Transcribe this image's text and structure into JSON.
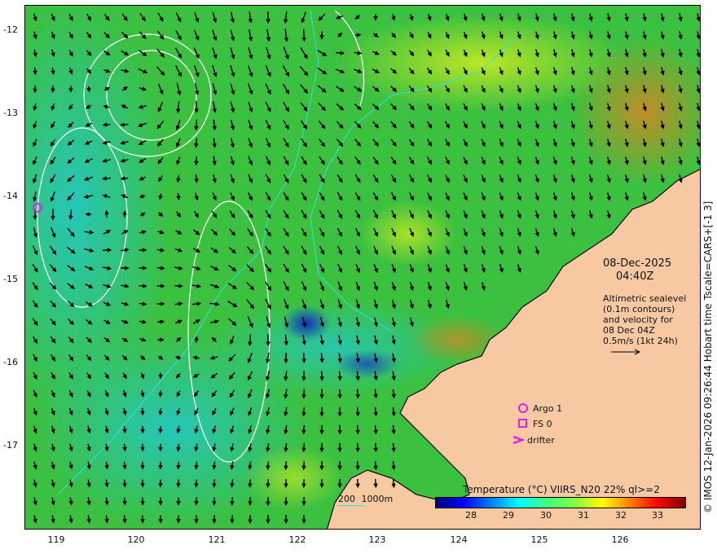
{
  "map": {
    "y_ticks": [
      "-12",
      "-13",
      "-14",
      "-15",
      "-16",
      "-17"
    ],
    "x_ticks": [
      "119",
      "120",
      "121",
      "122",
      "123",
      "124",
      "125",
      "126"
    ],
    "colors": {
      "land": "#f7c9a3",
      "sst_base": "#3fbf3f",
      "vector": "#000000",
      "contour": "#ffffff",
      "isobath": "#33e0e0"
    }
  },
  "annotations": {
    "date": "08-Dec-2025",
    "time": "04:40Z",
    "altimetry_lines": [
      "Altimetric sealevel",
      "(0.1m contours)",
      "and velocity for",
      "08 Dec 04Z",
      "0.5m/s (1kt 24h)"
    ]
  },
  "legend": {
    "argo": "Argo 1",
    "fs": "FS 0",
    "drifter": "drifter",
    "marker_color": "#e020e0"
  },
  "isobath_label": {
    "a": "200",
    "b": "1000m"
  },
  "colorbar": {
    "title": "Temperature (°C) VIIRS_N20 22% ql>=2",
    "ticks": [
      "28",
      "29",
      "30",
      "31",
      "32",
      "33"
    ],
    "stops": [
      "#00007f",
      "#0000ff",
      "#0080ff",
      "#00ffff",
      "#40ff80",
      "#80ff40",
      "#ffff00",
      "#ff8000",
      "#ff0000",
      "#7f0000"
    ]
  },
  "credit": "© IMOS 12-Jan-2026 09:26:44 Hobart time Tscale=CARS+[-1 3]"
}
